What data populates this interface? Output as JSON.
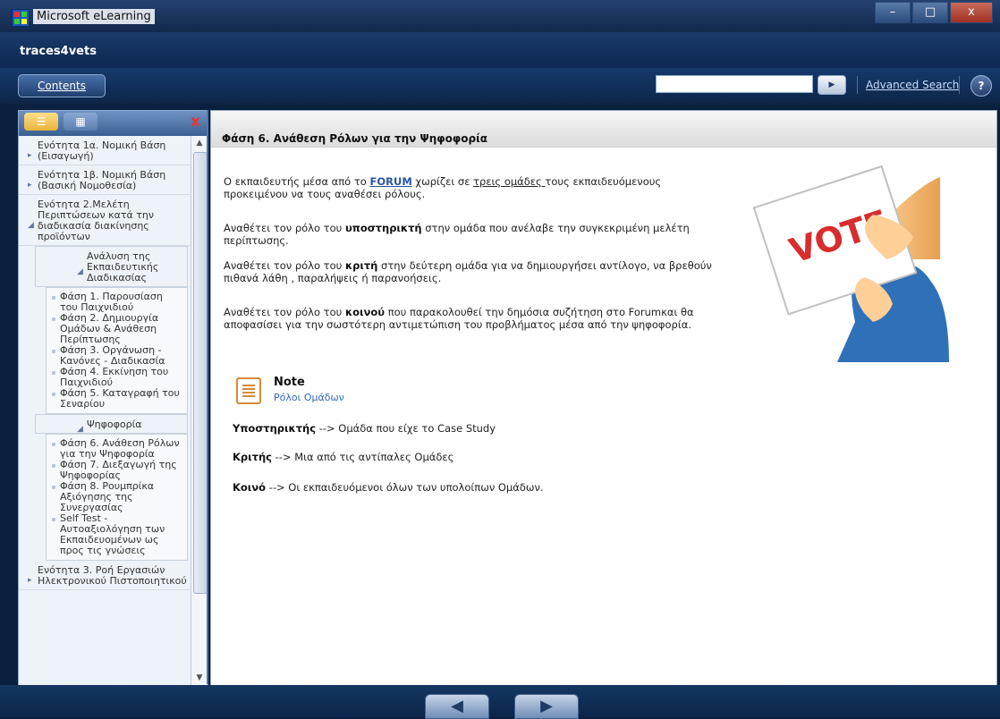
{
  "window": {
    "title": "Microsoft eLearning",
    "controls": {
      "minimize": "–",
      "maximize": "□",
      "close": "x"
    }
  },
  "brand": {
    "name": "traces4vets"
  },
  "toolbar": {
    "contents_label": "Contents",
    "search_placeholder": "",
    "search_go": "▶",
    "advanced_search": "Advanced Search",
    "help": "?"
  },
  "sidebar": {
    "tabs": {
      "list_icon": "list-icon",
      "grid_icon": "grid-icon"
    },
    "close": "x",
    "items": [
      {
        "label": "Ενότητα 1α. Νομική Βάση (Εισαγωγή)",
        "level": 0,
        "arrow": "collapsed"
      },
      {
        "label": "Ενότητα 1β. Νομική Βάση (Βασική Νομοθεσία)",
        "level": 0,
        "arrow": "collapsed"
      },
      {
        "label": "Ενότητα 2.Μελέτη Περιπτώσεων κατά την διαδικασία διακίνησης προϊόντων",
        "level": 0,
        "arrow": "expanded"
      },
      {
        "label": "Ανάλυση της Εκπαιδευτικής Διαδικασίας",
        "level": 1,
        "arrow": "expanded"
      },
      {
        "label": "Φάση 1. Παρουσίαση του Παιχνιδιού",
        "level": 2
      },
      {
        "label": "Φάση 2. Δημιουργία Ομάδων & Ανάθεση Περίπτωσης",
        "level": 2
      },
      {
        "label": "Φάση 3. Οργάνωση - Κανόνες - Διαδικασία",
        "level": 2
      },
      {
        "label": "Φάση 4. Εκκίνηση του Παιχνιδιού",
        "level": 2
      },
      {
        "label": "Φάση 5. Καταγραφή του Σεναρίου",
        "level": 2
      },
      {
        "label": "Ψηφοφορία",
        "level": 1,
        "arrow": "expanded"
      },
      {
        "label": "Φάση 6. Ανάθεση Ρόλων για την Ψηφοφορία",
        "level": 2,
        "selected": true
      },
      {
        "label": "Φάση 7. Διεξαγωγή της Ψηφοφορίας",
        "level": 2
      },
      {
        "label": "Φάση 8. Ρουμπρίκα Αξιόγησης της Συνεργασίας",
        "level": 2
      },
      {
        "label": "Self Test - Αυτοαξιολόγηση των Εκπαιδευομένων ως προς τις γνώσεις",
        "level": 2
      },
      {
        "label": "Ενότητα 3. Ροή Εργασιών Ηλεκτρονικού Πιστοποιητικού",
        "level": 0,
        "arrow": "collapsed"
      }
    ]
  },
  "content": {
    "title": "Φάση 6. Ανάθεση Ρόλων για την Ψηφοφορία",
    "p1_a": "Ο εκπαιδευτής μέσα από το ",
    "p1_forum": "FORUM",
    "p1_b": " χωρίζει σε ",
    "p1_groups": "τρεις ομάδες ",
    "p1_c": "τους εκπαιδευόμενους προκειμένου να τους αναθέσει ρόλους.",
    "p2_a": "Αναθέτει τον ρόλο του ",
    "p2_role": "υποστηρικτή",
    "p2_b": " στην ομάδα που ανέλαβε την συγκεκριμένη μελέτη περίπτωσης.",
    "p3_a": "Αναθέτει τον ρόλο του ",
    "p3_role": "κριτή",
    "p3_b": " στην δεύτερη ομάδα για να δημιουργήσει αντίλογο, να βρεθούν πιθανά λάθη , παραλήψεις ή παρανοήσεις.",
    "p4_a": " Αναθέτει τον ρόλο του ",
    "p4_role": "κοινού",
    "p4_b": " που παρακολουθεί την δημόσια συζήτηση στο Forumκαι θα αποφασίσει για την σωστότερη αντιμετώπιση του προβλήματος μέσα από την ψηφοφορία.",
    "note": {
      "title": "Note",
      "subtitle": "Ρόλοι Ομάδων"
    },
    "roles": [
      {
        "role": "Υποστηρικτής",
        "text": " --> Ομάδα που είχε το Case Study"
      },
      {
        "role": "Κριτής",
        "text": " --> Μια από τις αντίπαλες Ομάδες"
      },
      {
        "role": "Κοινό",
        "text": " --> Οι εκπαιδευόμενοι όλων των υπολοίπων Ομάδων."
      }
    ],
    "vote_text": "VOTE"
  },
  "bottom": {
    "prev": "◀",
    "next": "▶"
  }
}
